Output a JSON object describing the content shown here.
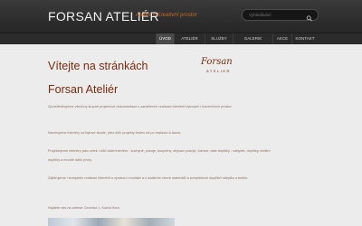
{
  "header": {
    "title": "FORSAN ATELIÉR",
    "subtitle": "Ateliér a Kreativní prostor",
    "search": {
      "placeholder": "Vyhledávání"
    }
  },
  "nav": {
    "items": [
      {
        "label": "ÚVOD",
        "active": true
      },
      {
        "label": "ATELIÉR",
        "active": false
      },
      {
        "label": "SLUŽBY",
        "active": false
      },
      {
        "label": "GALERIE PROJEKTŮ",
        "active": false
      },
      {
        "label": "AKCE",
        "active": false
      },
      {
        "label": "KONTAKT",
        "active": false
      }
    ]
  },
  "main": {
    "heading_1": "Vítejte na stránkách",
    "heading_2": "Forsan Ateliér",
    "logo": {
      "main": "Forsan",
      "sub": "ATELIER"
    },
    "paragraphs": [
      "Zprostředkujeme všechny stupně projektové dokumentace s zaměřením realizací interiérů bytových i komerčních prostor.",
      "Navrhujeme interiéry od bytové studie, přes dílčí projekty řešení až po realizaci a dozor.",
      "Projektujeme interiéry jako celek i dílčí části interiéru - kuchyně, pokoje, koupelny, obývací pokoje, ložnice; dále doplňky - nábytek, doplňky, textilní doplňky a mnohé další prvky.",
      "Zajišťujeme i kompletní realizaci interiérů s výrobou i montáží a s dodáním všech materiálů a kompletních doplňků nábytku a textilu.",
      "Najdete nás na adrese: Dvorská 1, Kutná Hora"
    ]
  },
  "colors": {
    "accent": "#7a2a0d",
    "header_bg": "#2f2f2f",
    "page_bg": "#ececec",
    "subtitle": "#c46a2a"
  }
}
